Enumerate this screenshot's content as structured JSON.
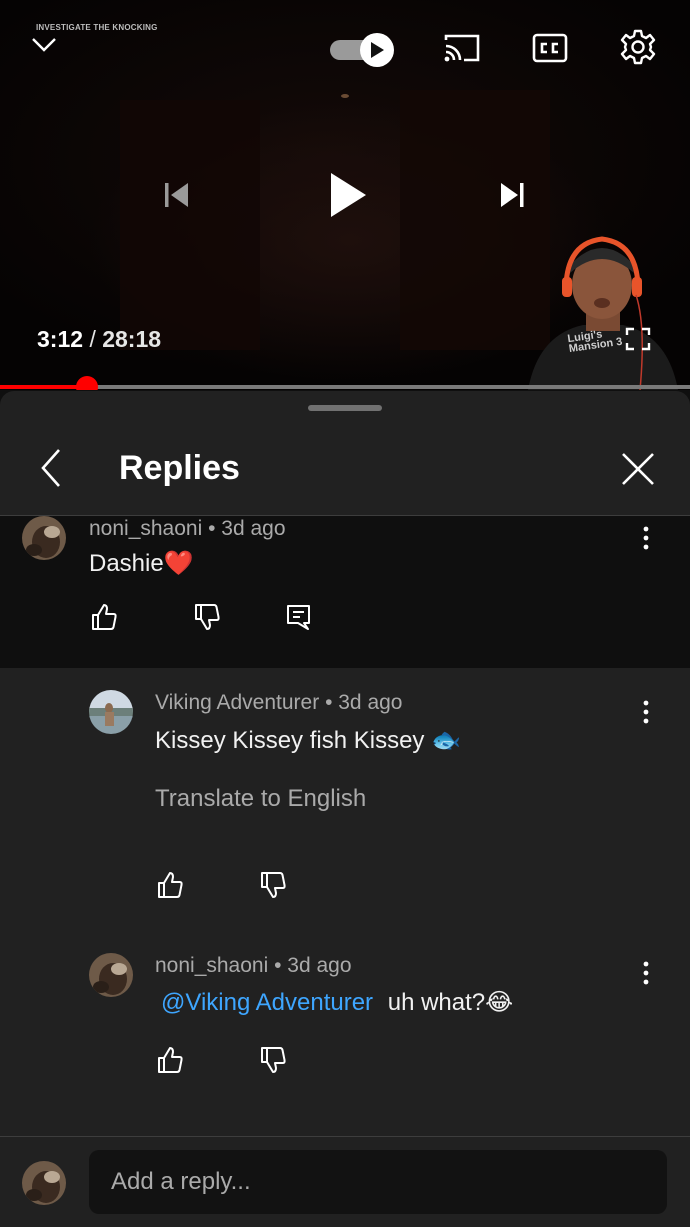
{
  "player": {
    "video_title": "INVESTIGATE THE KNOCKING",
    "current_time": "3:12",
    "separator": "/",
    "duration": "28:18",
    "progress_fraction": 0.126,
    "autoplay_on": true,
    "progress_color": "#ff0000",
    "shirt_text": "Luigi's Mansion 3"
  },
  "replies_panel": {
    "title": "Replies",
    "parent": {
      "author": "noni_shaoni",
      "age": "3d ago",
      "text": "Dashie",
      "emoji": "❤️"
    },
    "replies": [
      {
        "author": "Viking Adventurer",
        "age": "3d ago",
        "text": "Kissey Kissey fish Kissey",
        "emoji": "🐟",
        "translate_label": "Translate to English"
      },
      {
        "author": "noni_shaoni",
        "age": "3d ago",
        "mention": "@Viking Adventurer",
        "text": "uh what?",
        "emoji": "😂"
      }
    ],
    "composer": {
      "placeholder": "Add a reply..."
    }
  },
  "colors": {
    "link": "#3ea6ff",
    "sheet_bg": "#212121",
    "accent": "#ff0000"
  }
}
